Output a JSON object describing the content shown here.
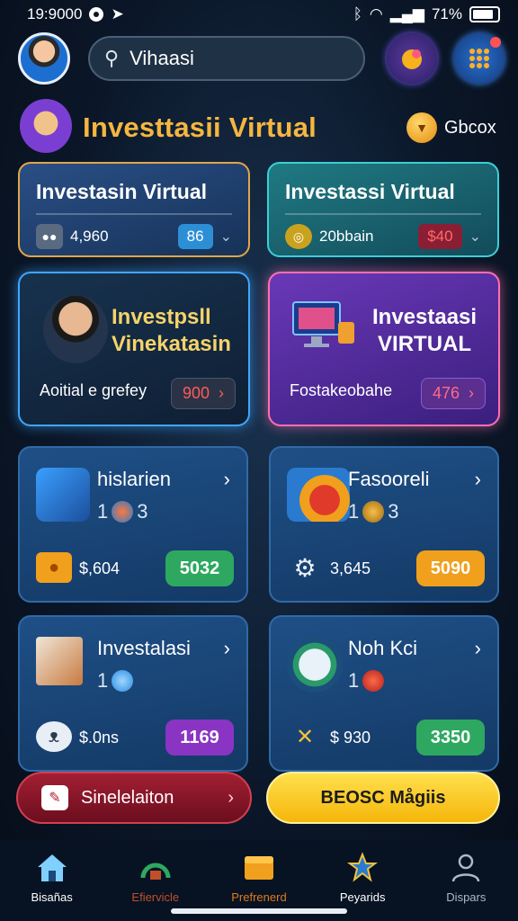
{
  "status_bar": {
    "time": "19:9000",
    "battery": "71%"
  },
  "header": {
    "search": {
      "value": "Vihaasi"
    },
    "title": "Investtasii Virtual",
    "gbox_label": "Gbcox"
  },
  "summary_cards": [
    {
      "title": "Investasin Virtual",
      "value": "4,960",
      "tag": "86"
    },
    {
      "title": "Investassi Virtual",
      "value": "20bbain",
      "price": "$40"
    }
  ],
  "feature_cards": [
    {
      "heading_line1": "Investpsll",
      "heading_line2": "Vinekatasin",
      "subtitle": "Aoitial e grefey",
      "price": "900"
    },
    {
      "heading_line1": "Investaasi",
      "heading_line2": "VIRTUAL",
      "subtitle": "Fostakeobahe",
      "price": "476"
    }
  ],
  "game_cards": [
    {
      "name": "hislarien",
      "count_a": "1",
      "count_b": "3",
      "price": "$,604",
      "button": "5032",
      "button_color": "#2ea860"
    },
    {
      "name": "Fasooreli",
      "count_a": "1",
      "count_b": "3",
      "price": "3,645",
      "button": "5090",
      "button_color": "#f0a01c"
    },
    {
      "name": "Investalasi",
      "count_a": "1",
      "count_b": "",
      "price": "$.0ns",
      "button": "1169",
      "button_color": "#8a34c4"
    },
    {
      "name": "Noh Kci",
      "count_a": "1",
      "count_b": "",
      "price": "$ 930",
      "button": "3350",
      "button_color": "#2ea860"
    }
  ],
  "cta": {
    "left_label": "Sinelelaiton",
    "right_label": "BEOSC Mågiis"
  },
  "nav": [
    {
      "label": "Bisañas",
      "color": "#ffffff"
    },
    {
      "label": "Efiervicle",
      "color": "#c0502a"
    },
    {
      "label": "Prefrenerd",
      "color": "#e07a1a"
    },
    {
      "label": "Peyarids",
      "color": "#ffffff"
    },
    {
      "label": "Dispars",
      "color": "#aeb8c6"
    }
  ]
}
